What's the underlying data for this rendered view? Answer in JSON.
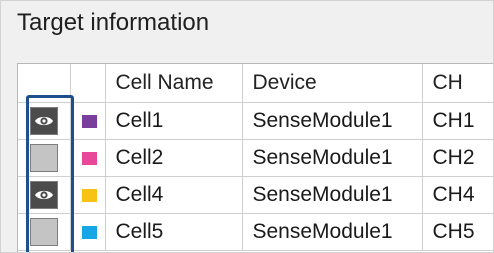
{
  "panel": {
    "title": "Target information"
  },
  "table": {
    "columns": [
      "",
      "",
      "Cell Name",
      "Device",
      "CH"
    ],
    "rows": [
      {
        "visible": true,
        "color": "#7a3e9d",
        "cell_name": "Cell1",
        "device": "SenseModule1",
        "ch": "CH1"
      },
      {
        "visible": false,
        "color": "#e8479a",
        "cell_name": "Cell2",
        "device": "SenseModule1",
        "ch": "CH2"
      },
      {
        "visible": true,
        "color": "#f7c317",
        "cell_name": "Cell4",
        "device": "SenseModule1",
        "ch": "CH4"
      },
      {
        "visible": false,
        "color": "#17a7e6",
        "cell_name": "Cell5",
        "device": "SenseModule1",
        "ch": "CH5"
      }
    ]
  },
  "icons": {
    "visibility_on": "eye-icon",
    "visibility_off": "blank-toggle"
  },
  "colors": {
    "highlight_frame": "#1f4f8c"
  }
}
